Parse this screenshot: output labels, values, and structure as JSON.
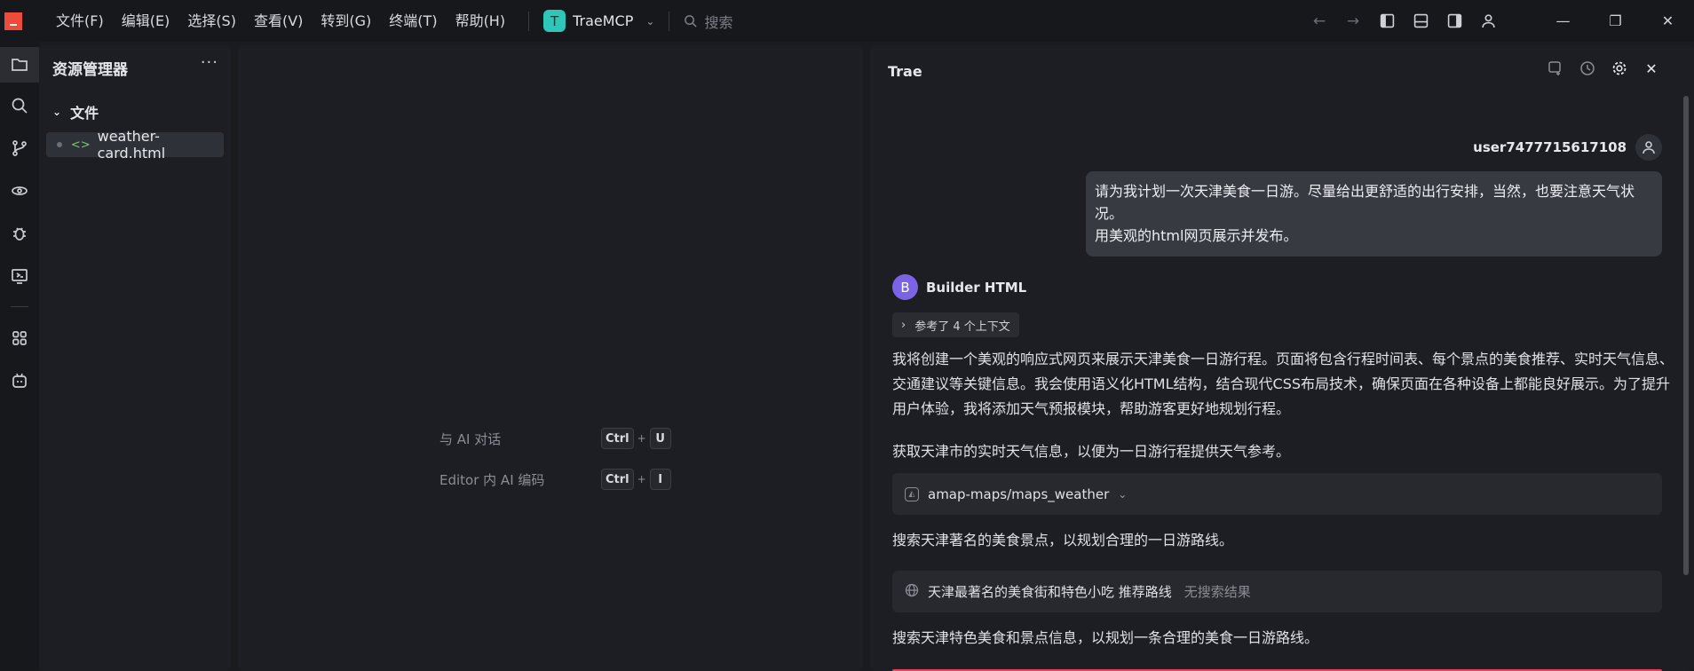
{
  "menu": [
    "文件(F)",
    "编辑(E)",
    "选择(S)",
    "查看(V)",
    "转到(G)",
    "终端(T)",
    "帮助(H)"
  ],
  "project": {
    "badge": "T",
    "name": "TraeMCP"
  },
  "search": {
    "placeholder": "搜索"
  },
  "explorer": {
    "title": "资源管理器",
    "more": "···",
    "folder": "文件",
    "file": "weather-card.html"
  },
  "editor": {
    "hints": [
      {
        "label": "与 AI 对话",
        "keys": [
          "Ctrl",
          "U"
        ]
      },
      {
        "label": "Editor 内 AI 编码",
        "keys": [
          "Ctrl",
          "I"
        ]
      }
    ]
  },
  "chat": {
    "title": "Trae",
    "user": {
      "name": "user7477715617108",
      "message_line1": "请为我计划一次天津美食一日游。尽量给出更舒适的出行安排，当然，也要注意天气状况。",
      "message_line2": "用美观的html网页展示并发布。"
    },
    "bot": {
      "avatar": "B",
      "name": "Builder HTML",
      "context": "参考了 4 个上下文",
      "intro": "我将创建一个美观的响应式网页来展示天津美食一日游行程。页面将包含行程时间表、每个景点的美食推荐、实时天气信息、交通建议等关键信息。我会使用语义化HTML结构，结合现代CSS布局技术，确保页面在各种设备上都能良好展示。为了提升用户体验，我将添加天气预报模块，帮助游客更好地规划行程。",
      "step1": "获取天津市的实时天气信息，以便为一日游行程提供天气参考。",
      "tool1": "amap-maps/maps_weather",
      "step2": "搜索天津著名的美食景点，以规划合理的一日游路线。",
      "tool2": "天津最著名的美食街和特色小吃 推荐路线",
      "tool2_status": "无搜索结果",
      "step3": "搜索天津特色美食和景点信息，以规划一条合理的美食一日游路线。"
    }
  }
}
